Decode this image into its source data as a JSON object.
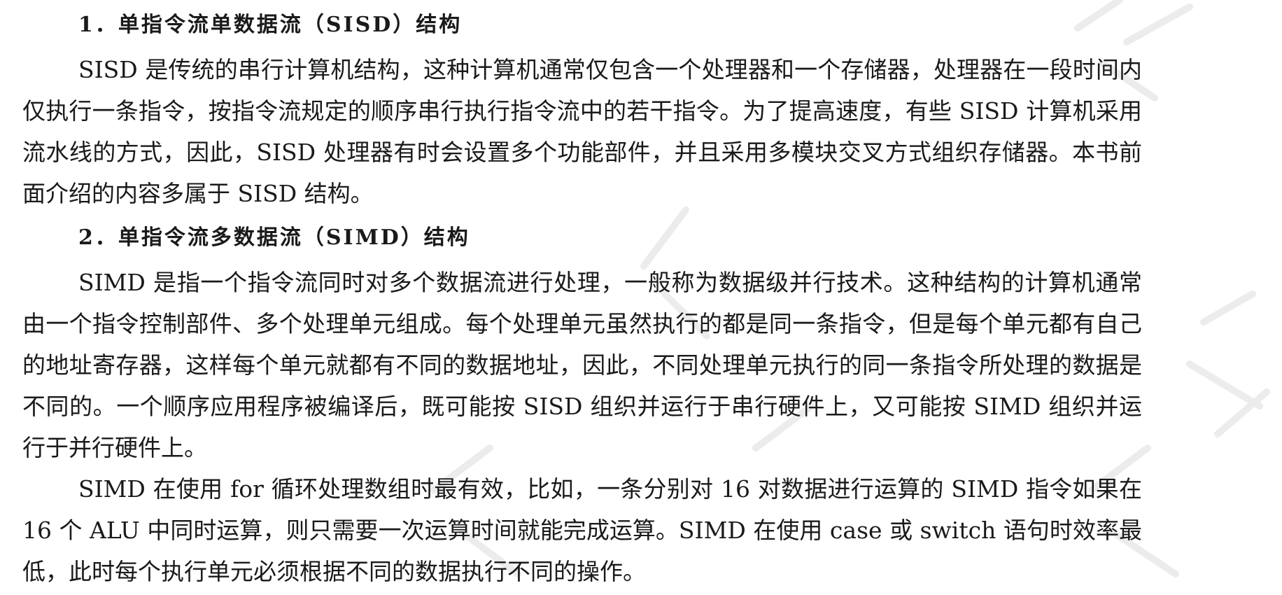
{
  "sections": [
    {
      "heading": "1．单指令流单数据流（SISD）结构",
      "paragraphs": [
        "SISD 是传统的串行计算机结构，这种计算机通常仅包含一个处理器和一个存储器，处理器在一段时间内仅执行一条指令，按指令流规定的顺序串行执行指令流中的若干指令。为了提高速度，有些 SISD 计算机采用流水线的方式，因此，SISD 处理器有时会设置多个功能部件，并且采用多模块交叉方式组织存储器。本书前面介绍的内容多属于 SISD 结构。"
      ]
    },
    {
      "heading": "2．单指令流多数据流（SIMD）结构",
      "paragraphs": [
        "SIMD 是指一个指令流同时对多个数据流进行处理，一般称为数据级并行技术。这种结构的计算机通常由一个指令控制部件、多个处理单元组成。每个处理单元虽然执行的都是同一条指令，但是每个单元都有自己的地址寄存器，这样每个单元就都有不同的数据地址，因此，不同处理单元执行的同一条指令所处理的数据是不同的。一个顺序应用程序被编译后，既可能按 SISD 组织并运行于串行硬件上，又可能按 SIMD 组织并运行于并行硬件上。",
        "SIMD 在使用 for 循环处理数组时最有效，比如，一条分别对 16 对数据进行运算的 SIMD 指令如果在 16 个 ALU 中同时运算，则只需要一次运算时间就能完成运算。SIMD 在使用 case 或 switch 语句时效率最低，此时每个执行单元必须根据不同的数据执行不同的操作。"
      ]
    }
  ]
}
